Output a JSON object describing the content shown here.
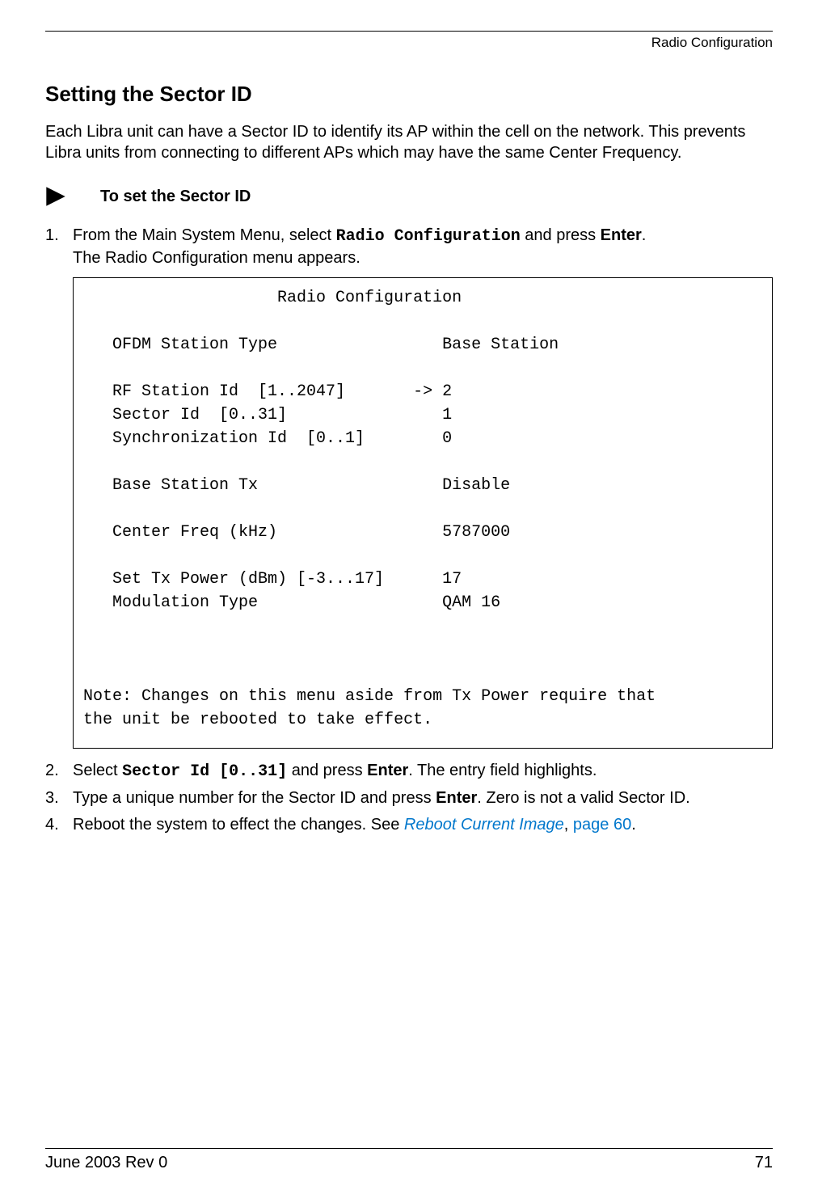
{
  "header": {
    "label": "Radio Configuration"
  },
  "section": {
    "title": "Setting the Sector ID",
    "intro": "Each Libra unit can have a Sector ID to identify its AP within the cell on the network. This prevents Libra units from connecting to different APs which may have the same Center Frequency."
  },
  "procedure": {
    "heading": "To set the Sector ID"
  },
  "steps": {
    "s1": {
      "num": "1.",
      "pre": "From the Main System Menu, select ",
      "code": "Radio Configuration",
      "mid": " and press ",
      "bold": "Enter",
      "post": ".",
      "line2": "The Radio Configuration menu appears."
    },
    "s2": {
      "num": "2.",
      "pre": "Select ",
      "code": "Sector Id [0..31]",
      "mid": " and press ",
      "bold": "Enter",
      "post": ". The entry field highlights."
    },
    "s3": {
      "num": "3.",
      "pre": "Type a unique number for the Sector ID and press ",
      "bold": "Enter",
      "post": ". Zero is not a valid Sector ID."
    },
    "s4": {
      "num": "4.",
      "pre": "Reboot the system to effect the changes. See ",
      "link": "Reboot Current Image",
      "comma": ", ",
      "linkpage": "page 60",
      "post": "."
    }
  },
  "terminal": {
    "title": "                    Radio Configuration",
    "l_ofdm": "   OFDM Station Type                 Base Station",
    "l_rf": "   RF Station Id  [1..2047]       -> 2",
    "l_sector": "   Sector Id  [0..31]                1",
    "l_sync": "   Synchronization Id  [0..1]        0",
    "l_bstx": "   Base Station Tx                   Disable",
    "l_cf": "   Center Freq (kHz)                 5787000",
    "l_pow": "   Set Tx Power (dBm) [-3...17]      17",
    "l_mod": "   Modulation Type                   QAM 16",
    "note1": "Note: Changes on this menu aside from Tx Power require that",
    "note2": "the unit be rebooted to take effect."
  },
  "footer": {
    "left": "June 2003 Rev 0",
    "right": "71"
  }
}
